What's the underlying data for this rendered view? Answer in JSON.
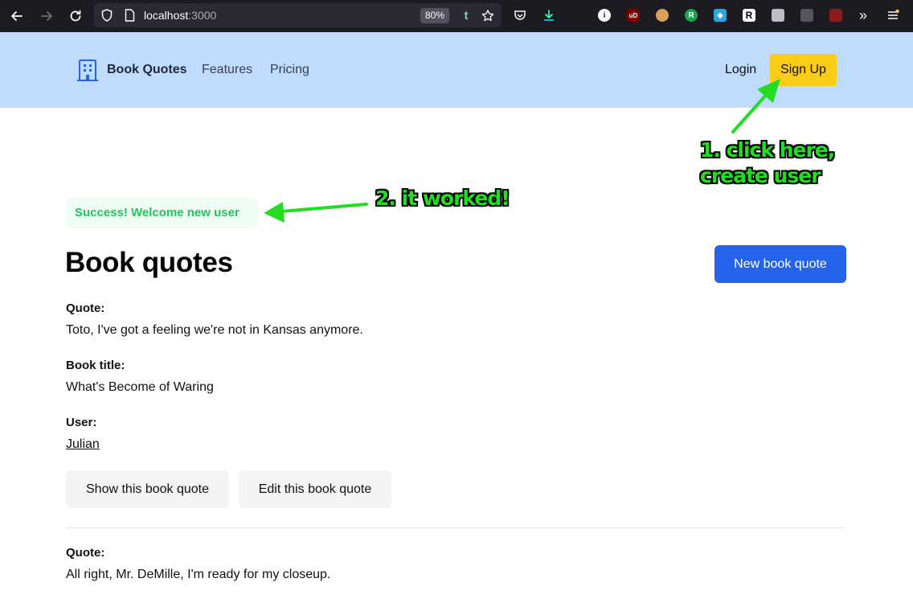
{
  "browser": {
    "url_host": "localhost",
    "url_port": ":3000",
    "zoom": "80%"
  },
  "navbar": {
    "brand": "Book Quotes",
    "links": [
      "Features",
      "Pricing"
    ],
    "login": "Login",
    "signup": "Sign Up"
  },
  "flash": "Success! Welcome new user",
  "page_title": "Book quotes",
  "new_button": "New book quote",
  "quotes": [
    {
      "quote_label": "Quote:",
      "quote": "Toto, I've got a feeling we're not in Kansas anymore.",
      "title_label": "Book title:",
      "title": "What's Become of Waring",
      "user_label": "User:",
      "user": "Julian",
      "show_label": "Show this book quote",
      "edit_label": "Edit this book quote"
    },
    {
      "quote_label": "Quote:",
      "quote": "All right, Mr. DeMille, I'm ready for my closeup."
    }
  ],
  "annotations": {
    "step1_line1": "1. click here,",
    "step1_line2": "create user",
    "step2": "2. it worked!"
  },
  "colors": {
    "navbar_bg": "#bfdbfe",
    "signup_bg": "#facc15",
    "primary": "#2563eb",
    "success": "#22c55e",
    "annotation": "#22dd22"
  }
}
